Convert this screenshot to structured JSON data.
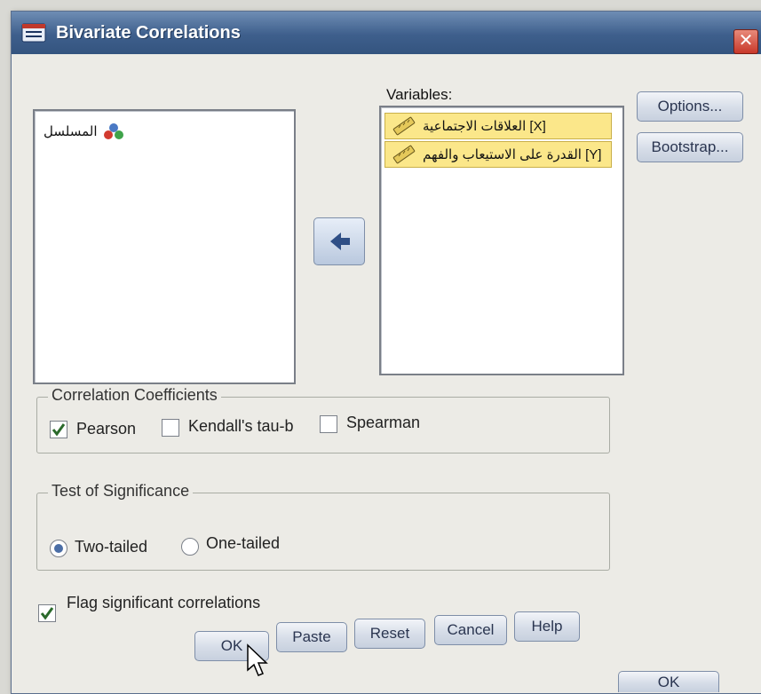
{
  "dialog": {
    "title": "Bivariate Correlations",
    "close_glyph": "✕"
  },
  "source_list": {
    "items": [
      {
        "label": "المسلسل",
        "icon": "nominal-variable-icon"
      }
    ]
  },
  "variables": {
    "label": "Variables:",
    "items": [
      {
        "label": "العلاقات الاجتماعية [X]",
        "icon": "scale-variable-icon"
      },
      {
        "label": "القدرة على الاستيعاب والفهم [Y]",
        "icon": "scale-variable-icon"
      }
    ]
  },
  "side_buttons": {
    "options": "Options...",
    "bootstrap": "Bootstrap..."
  },
  "move_button": {
    "icon": "move-arrow-icon"
  },
  "correlation": {
    "title": "Correlation Coefficients",
    "pearson": "Pearson",
    "pearson_checked": true,
    "kendall": "Kendall's tau-b",
    "kendall_checked": false,
    "spearman": "Spearman",
    "spearman_checked": false
  },
  "significance": {
    "title": "Test of Significance",
    "two_tailed": "Two-tailed",
    "one_tailed": "One-tailed",
    "selected": "two_tailed"
  },
  "flag": {
    "label": "Flag significant correlations",
    "checked": true
  },
  "footer": {
    "ok": "OK",
    "paste": "Paste",
    "reset": "Reset",
    "cancel": "Cancel",
    "help": "Help"
  },
  "background_button": {
    "label": "OK"
  }
}
